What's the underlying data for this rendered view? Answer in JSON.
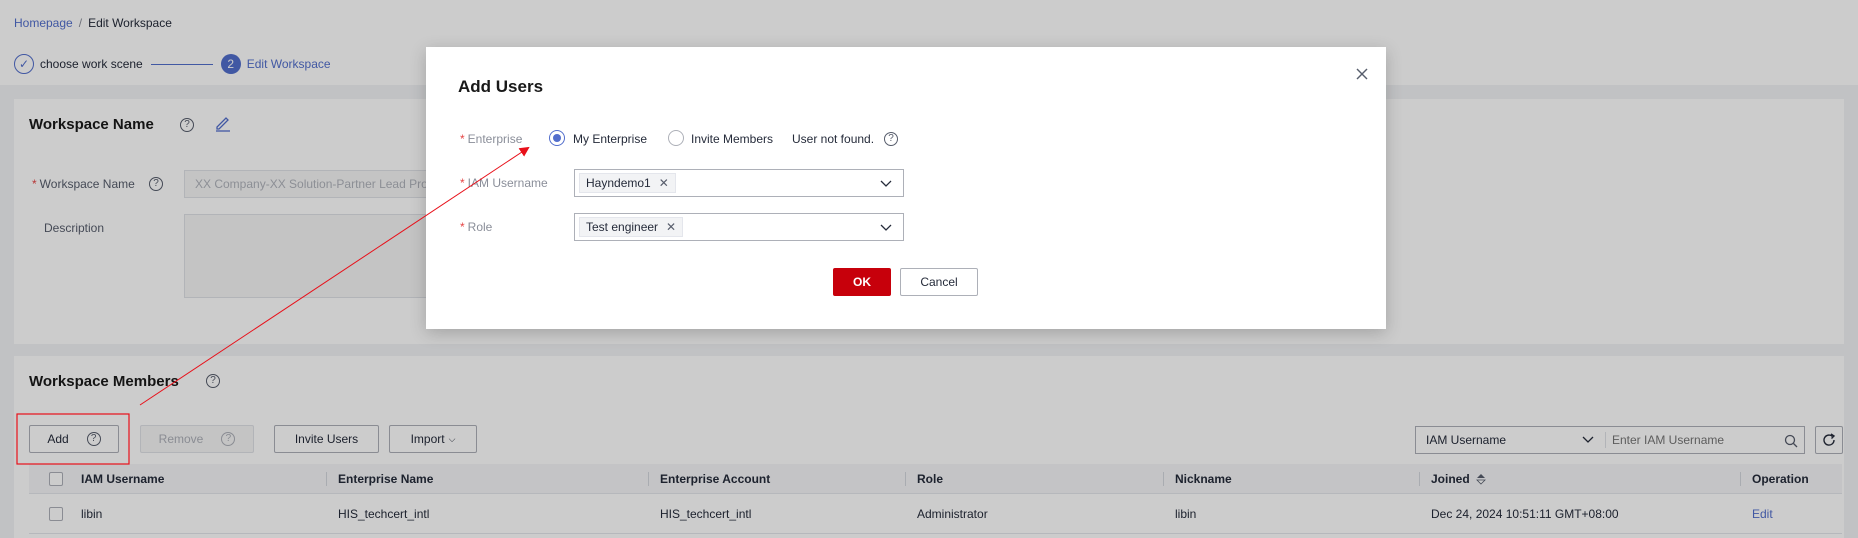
{
  "breadcrumb": {
    "home": "Homepage",
    "separator": "/",
    "current": "Edit Workspace"
  },
  "steps": [
    {
      "number": "✓",
      "label": "choose work scene",
      "state": "done"
    },
    {
      "number": "2",
      "label": "Edit Workspace",
      "state": "current"
    }
  ],
  "workspace": {
    "title": "Workspace Name",
    "name_label": "Workspace Name",
    "name_value": "XX Company-XX Solution-Partner Lead Pro",
    "description_label": "Description"
  },
  "members": {
    "title": "Workspace Members",
    "buttons": {
      "add": "Add",
      "remove": "Remove",
      "invite": "Invite Users",
      "import": "Import"
    },
    "filter_select": "IAM Username",
    "filter_placeholder": "Enter IAM Username",
    "columns": [
      "IAM Username",
      "Enterprise Name",
      "Enterprise Account",
      "Role",
      "Nickname",
      "Joined",
      "Operation"
    ],
    "rows": [
      {
        "iam_username": "libin",
        "enterprise_name": "HIS_techcert_intl",
        "enterprise_account": "HIS_techcert_intl",
        "role": "Administrator",
        "nickname": "libin",
        "joined": "Dec 24, 2024 10:51:11 GMT+08:00",
        "operation": "Edit"
      }
    ]
  },
  "modal": {
    "title": "Add Users",
    "enterprise_label": "Enterprise",
    "option_my_enterprise": "My Enterprise",
    "option_invite_members": "Invite Members",
    "user_not_found": "User not found.",
    "iam_label": "IAM Username",
    "iam_tag": "Hayndemo1",
    "role_label": "Role",
    "role_tag": "Test engineer",
    "ok": "OK",
    "cancel": "Cancel"
  },
  "colors": {
    "primary": "#526ecc",
    "danger": "#c7000b",
    "annotation": "#e8101a"
  }
}
